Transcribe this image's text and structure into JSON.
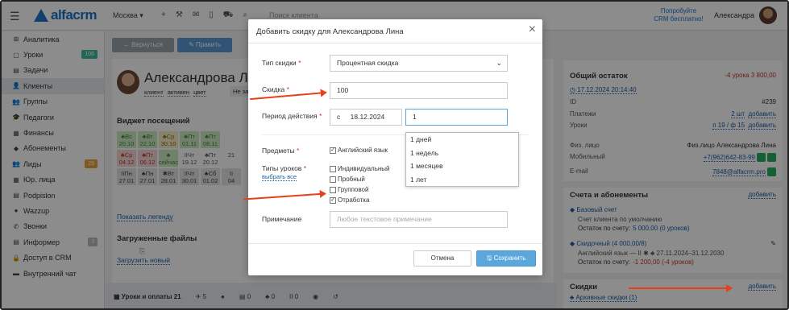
{
  "topbar": {
    "logo": "alfacrm",
    "branch": "Москва ▾",
    "search_placeholder": "Поиск клиента",
    "promo": "Попробуйте CRM бесплатно!",
    "user_name": "Александра"
  },
  "sidebar": {
    "items": [
      {
        "label": "Аналитика",
        "icon": "⊞"
      },
      {
        "label": "Уроки",
        "icon": "▢",
        "badge": "106",
        "badge_color": "#3bb99b"
      },
      {
        "label": "Задачи",
        "icon": "▤"
      },
      {
        "label": "Клиенты",
        "icon": "👤"
      },
      {
        "label": "Группы",
        "icon": "👥"
      },
      {
        "label": "Педагоги",
        "icon": "🎓"
      },
      {
        "label": "Финансы",
        "icon": "▦"
      },
      {
        "label": "Абонементы",
        "icon": "◆"
      },
      {
        "label": "Лиды",
        "icon": "👥",
        "badge": "25",
        "badge_color": "#e8a33c"
      },
      {
        "label": "Юр. лица",
        "icon": "▦"
      },
      {
        "label": "Podpislon",
        "icon": "▤"
      },
      {
        "label": "Wazzup",
        "icon": "●"
      },
      {
        "label": "Звонки",
        "icon": "✆"
      },
      {
        "label": "Информер",
        "icon": "▤",
        "badge": "3",
        "badge_color": "#bbbbbb"
      },
      {
        "label": "Доступ в CRM",
        "icon": "🔒"
      },
      {
        "label": "Внутренний чат",
        "icon": "▬"
      }
    ]
  },
  "main": {
    "back_label": "← Вернуться",
    "edit_label": "✎ Править",
    "client_name": "Александрова Лина",
    "tags": [
      "клиент",
      "активен",
      "цвет"
    ],
    "tag_box": "Не зад",
    "attendance_title": "Виджет посещений",
    "attendance": [
      {
        "d": "♣Вс",
        "n": "20.10",
        "c": "green"
      },
      {
        "d": "♣Вт",
        "n": "22.10",
        "c": "green"
      },
      {
        "d": "♣Ср",
        "n": "30.10",
        "c": "yellow"
      },
      {
        "d": "♣Пт",
        "n": "01.11",
        "c": "green"
      },
      {
        "d": "♣Пт",
        "n": "08.11",
        "c": "green"
      },
      {
        "d": "",
        "n": "",
        "c": "plain"
      },
      {
        "d": "♣Ср",
        "n": "04.12",
        "c": "pink"
      },
      {
        "d": "♣Пт",
        "n": "06.12",
        "c": "pink"
      },
      {
        "d": "♣",
        "n": "сейчас",
        "c": "green"
      },
      {
        "d": "IIЧт",
        "n": "19.12",
        "c": "plain"
      },
      {
        "d": "♣Пт",
        "n": "20.12",
        "c": "plain"
      },
      {
        "d": "",
        "n": "21",
        "c": "plain"
      },
      {
        "d": "IIПн",
        "n": "27.01",
        "c": "gray"
      },
      {
        "d": "♣Пн",
        "n": "27.01",
        "c": "gray"
      },
      {
        "d": "✱Вт",
        "n": "28.01",
        "c": "gray"
      },
      {
        "d": "IIЧт",
        "n": "30.01",
        "c": "gray"
      },
      {
        "d": "♣Сб",
        "n": "01.02",
        "c": "gray"
      },
      {
        "d": "II",
        "n": "04",
        "c": "gray"
      }
    ],
    "legend_link": "Показать легенду",
    "files_title": "Загруженные файлы",
    "upload_link": "Загрузить новый",
    "tabs": [
      "▦ Уроки и оплаты 21",
      "✈ 5",
      "●",
      "▤ 0",
      "♣ 0",
      "II 0",
      "◉",
      "↺"
    ]
  },
  "right": {
    "balance_title": "Общий остаток",
    "balance_value": "-4 урока   3 800,00",
    "balance_date": "◷ 17.12.2024 20:14:40",
    "id_label": "ID",
    "id_value": "#239",
    "payments_label": "Платежи",
    "payments_value": "2 шт",
    "payments_add": "добавить",
    "lessons_label": "Уроки",
    "lessons_value": "п 19 / ф 15",
    "lessons_add": "добавить",
    "person_label": "Физ. лицо",
    "person_value": "Физ.лицо Александрова Лина",
    "mobile_label": "Мобильный",
    "mobile_value": "+7(962)642-83-99",
    "email_label": "E-mail",
    "email_value": "7848@alfacrm.pro",
    "accounts_title": "Счета и абонементы",
    "accounts_add": "добавить",
    "base_account": "◆ Базовый счет",
    "base_desc": "Счет клиента по умолчанию",
    "base_balance_label": "Остаток по счету:",
    "base_balance_value": "5 000,00 (0 уроков)",
    "discount_account": "◆ Скидочный (4 000,00/8)",
    "discount_desc": "Английский язык — II ✱ ♣  27.11.2024–31.12.2030",
    "discount_balance_label": "Остаток по счету:",
    "discount_balance_value": "-1 200,00 (-4 уроков)",
    "discounts_title": "Скидки",
    "discounts_add": "добавить",
    "archive_link": "♣ Архивные скидки (1)"
  },
  "modal": {
    "title": "Добавить скидку для Александрова Лина",
    "type_label": "Тип скидки",
    "type_value": "Процентная скидка",
    "discount_label": "Скидка",
    "discount_value": "100",
    "period_label": "Период действия",
    "period_from": "с",
    "period_date": "18.12.2024",
    "period_count": "1",
    "period_options": [
      "1 дней",
      "1 недель",
      "1 месяцев",
      "1 лет"
    ],
    "subjects_label": "Предметы",
    "subject_english": "Английский язык",
    "lesson_types_label": "Типы уроков",
    "select_all": "выбрать все",
    "lesson_types": [
      {
        "label": "Индивидуальный",
        "checked": false
      },
      {
        "label": "Пробный",
        "checked": false
      },
      {
        "label": "Групповой",
        "checked": false
      },
      {
        "label": "Отработка",
        "checked": true
      }
    ],
    "note_label": "Примечание",
    "note_placeholder": "Любое текстовое примечание",
    "cancel_label": "Отмена",
    "save_label": "🖫 Сохранить"
  },
  "colors": {
    "accent": "#1a73c9",
    "arrow": "#e8401c",
    "save": "#5aa6dd"
  }
}
